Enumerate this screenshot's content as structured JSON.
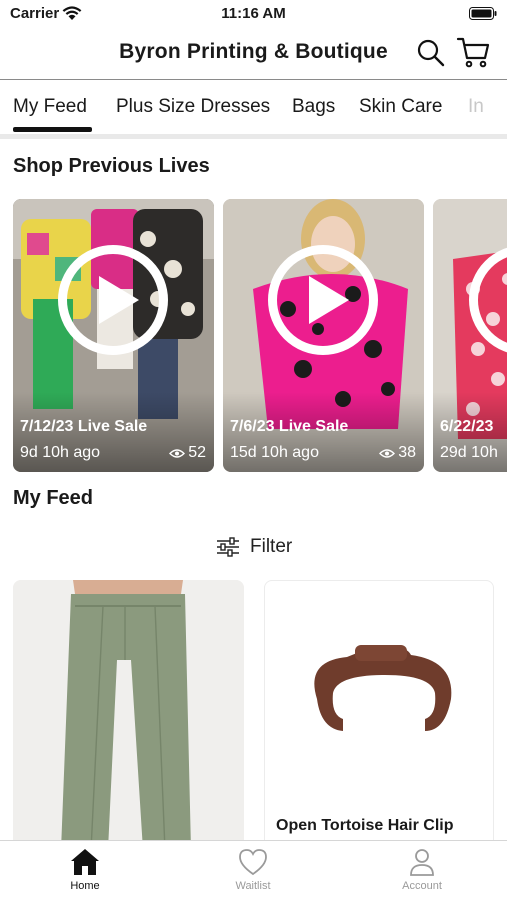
{
  "status_bar": {
    "carrier": "Carrier",
    "time": "11:16 AM"
  },
  "header": {
    "title": "Byron Printing & Boutique",
    "search_icon": "search-icon",
    "cart_icon": "cart-icon"
  },
  "tabs": [
    {
      "label": "My Feed",
      "selected": true
    },
    {
      "label": "Plus Size Dresses"
    },
    {
      "label": "Bags"
    },
    {
      "label": "Skin Care"
    },
    {
      "label": "In"
    }
  ],
  "lives": {
    "title": "Shop Previous Lives",
    "items": [
      {
        "name": "7/12/23 Live Sale",
        "ago": "9d 10h ago",
        "views": "52"
      },
      {
        "name": "7/6/23 Live Sale",
        "ago": "15d 10h ago",
        "views": "38"
      },
      {
        "name": "6/22/23",
        "ago": "29d 10h"
      }
    ]
  },
  "feed": {
    "title": "My Feed",
    "filter_label": "Filter",
    "products": [
      {
        "name": ""
      },
      {
        "name": "Open Tortoise Hair Clip"
      }
    ]
  },
  "bottom_nav": [
    {
      "label": "Home",
      "icon": "home-icon",
      "active": true
    },
    {
      "label": "Waitlist",
      "icon": "heart-icon"
    },
    {
      "label": "Account",
      "icon": "person-icon"
    }
  ],
  "colors": {
    "accent": "#111111",
    "inactive_nav": "#9a9a9a",
    "divider": "#e9e9e9"
  }
}
